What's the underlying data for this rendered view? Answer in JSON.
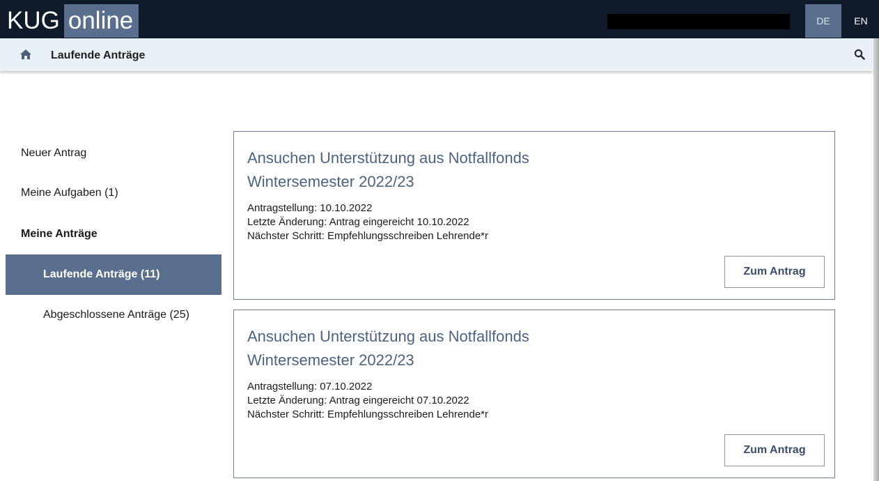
{
  "header": {
    "logo_part1": "KUG",
    "logo_part2": "online",
    "languages": [
      {
        "code": "DE",
        "active": true
      },
      {
        "code": "EN",
        "active": false
      }
    ]
  },
  "breadcrumb": {
    "title": "Laufende Anträge",
    "home_icon": "home-icon",
    "search_icon": "search-icon"
  },
  "sidebar": {
    "items": [
      {
        "label": "Neuer Antrag"
      },
      {
        "label": "Meine Aufgaben (1)"
      },
      {
        "label": "Meine Anträge"
      },
      {
        "label": "Laufende Anträge (11)",
        "active": true
      },
      {
        "label": "Abgeschlossene Anträge (25)"
      }
    ]
  },
  "applications": [
    {
      "title_line1": "Ansuchen Unterstützung aus Notfallfonds",
      "title_line2": "Wintersemester 2022/23",
      "submitted": "Antragstellung: 10.10.2022",
      "last_change": "Letzte Änderung: Antrag eingereicht 10.10.2022",
      "next_step": "Nächster Schritt: Empfehlungsschreiben Lehrende*r",
      "button_label": "Zum Antrag"
    },
    {
      "title_line1": "Ansuchen Unterstützung aus Notfallfonds",
      "title_line2": "Wintersemester 2022/23",
      "submitted": "Antragstellung: 07.10.2022",
      "last_change": "Letzte Änderung: Antrag eingereicht 07.10.2022",
      "next_step": "Nächster Schritt: Empfehlungsschreiben Lehrende*r",
      "button_label": "Zum Antrag"
    }
  ],
  "colors": {
    "topbar": "#0f1a2a",
    "accent": "#5a6f8e",
    "breadcrumb_bg": "#eaf0f7",
    "title_link": "#4a6284"
  }
}
